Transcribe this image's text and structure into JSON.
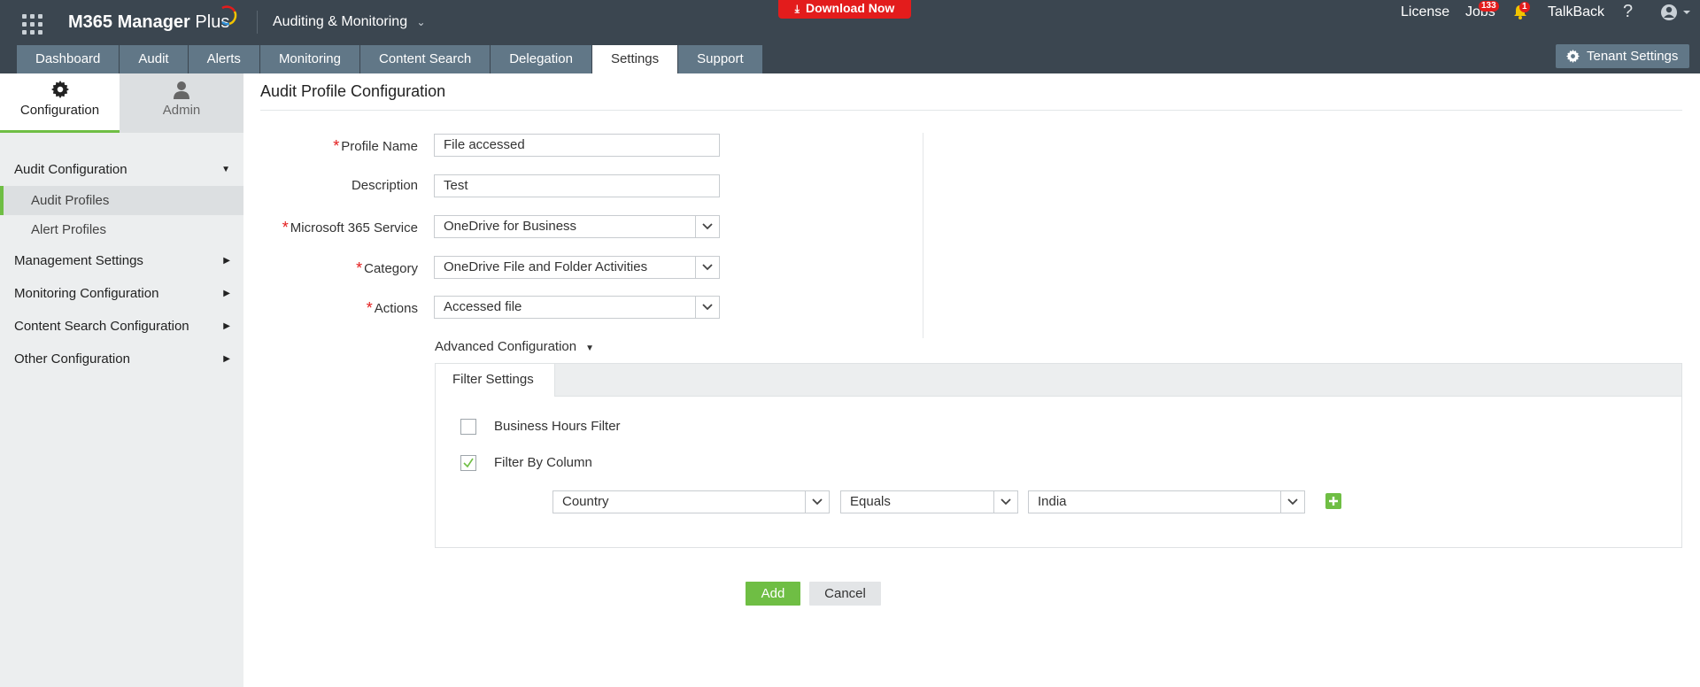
{
  "header": {
    "app_title": "M365 Manager",
    "app_title_suffix": "Plus",
    "module": "Auditing & Monitoring",
    "download_label": "Download Now",
    "links": {
      "license": "License",
      "jobs": "Jobs",
      "jobs_badge": "133",
      "notifications_badge": "1",
      "talkback": "TalkBack",
      "help": "?"
    },
    "tenant_settings": "Tenant Settings",
    "colors": {
      "bar": "#3b4650",
      "tab": "#617787",
      "download": "#e31c1c"
    }
  },
  "tabs": [
    {
      "label": "Dashboard",
      "active": false
    },
    {
      "label": "Audit",
      "active": false
    },
    {
      "label": "Alerts",
      "active": false
    },
    {
      "label": "Monitoring",
      "active": false
    },
    {
      "label": "Content Search",
      "active": false
    },
    {
      "label": "Delegation",
      "active": false
    },
    {
      "label": "Settings",
      "active": true
    },
    {
      "label": "Support",
      "active": false
    }
  ],
  "sidebar": {
    "tabs": [
      {
        "label": "Configuration",
        "icon": "gear-icon",
        "active": true
      },
      {
        "label": "Admin",
        "icon": "user-icon",
        "active": false
      }
    ],
    "groups": [
      {
        "label": "Audit Configuration",
        "expanded": true,
        "items": [
          {
            "label": "Audit Profiles",
            "active": true
          },
          {
            "label": "Alert Profiles",
            "active": false
          }
        ]
      },
      {
        "label": "Management Settings",
        "expanded": false
      },
      {
        "label": "Monitoring Configuration",
        "expanded": false
      },
      {
        "label": "Content Search Configuration",
        "expanded": false
      },
      {
        "label": "Other Configuration",
        "expanded": false
      }
    ],
    "accent": "#6fbe44"
  },
  "main": {
    "title": "Audit Profile Configuration",
    "form": {
      "profile_name": {
        "label": "Profile Name",
        "required": true,
        "value": "File accessed"
      },
      "description": {
        "label": "Description",
        "required": false,
        "value": "Test"
      },
      "service": {
        "label": "Microsoft 365 Service",
        "required": true,
        "value": "OneDrive for Business"
      },
      "category": {
        "label": "Category",
        "required": true,
        "value": "OneDrive File and Folder Activities"
      },
      "actions": {
        "label": "Actions",
        "required": true,
        "value": "Accessed file"
      }
    },
    "advanced_label": "Advanced Configuration",
    "filter_tab": "Filter Settings",
    "business_hours": {
      "label": "Business Hours Filter",
      "checked": false
    },
    "filter_by_column": {
      "label": "Filter By Column",
      "checked": true
    },
    "column_filter": {
      "column": "Country",
      "operator": "Equals",
      "value": "India"
    },
    "buttons": {
      "add": "Add",
      "cancel": "Cancel"
    }
  }
}
